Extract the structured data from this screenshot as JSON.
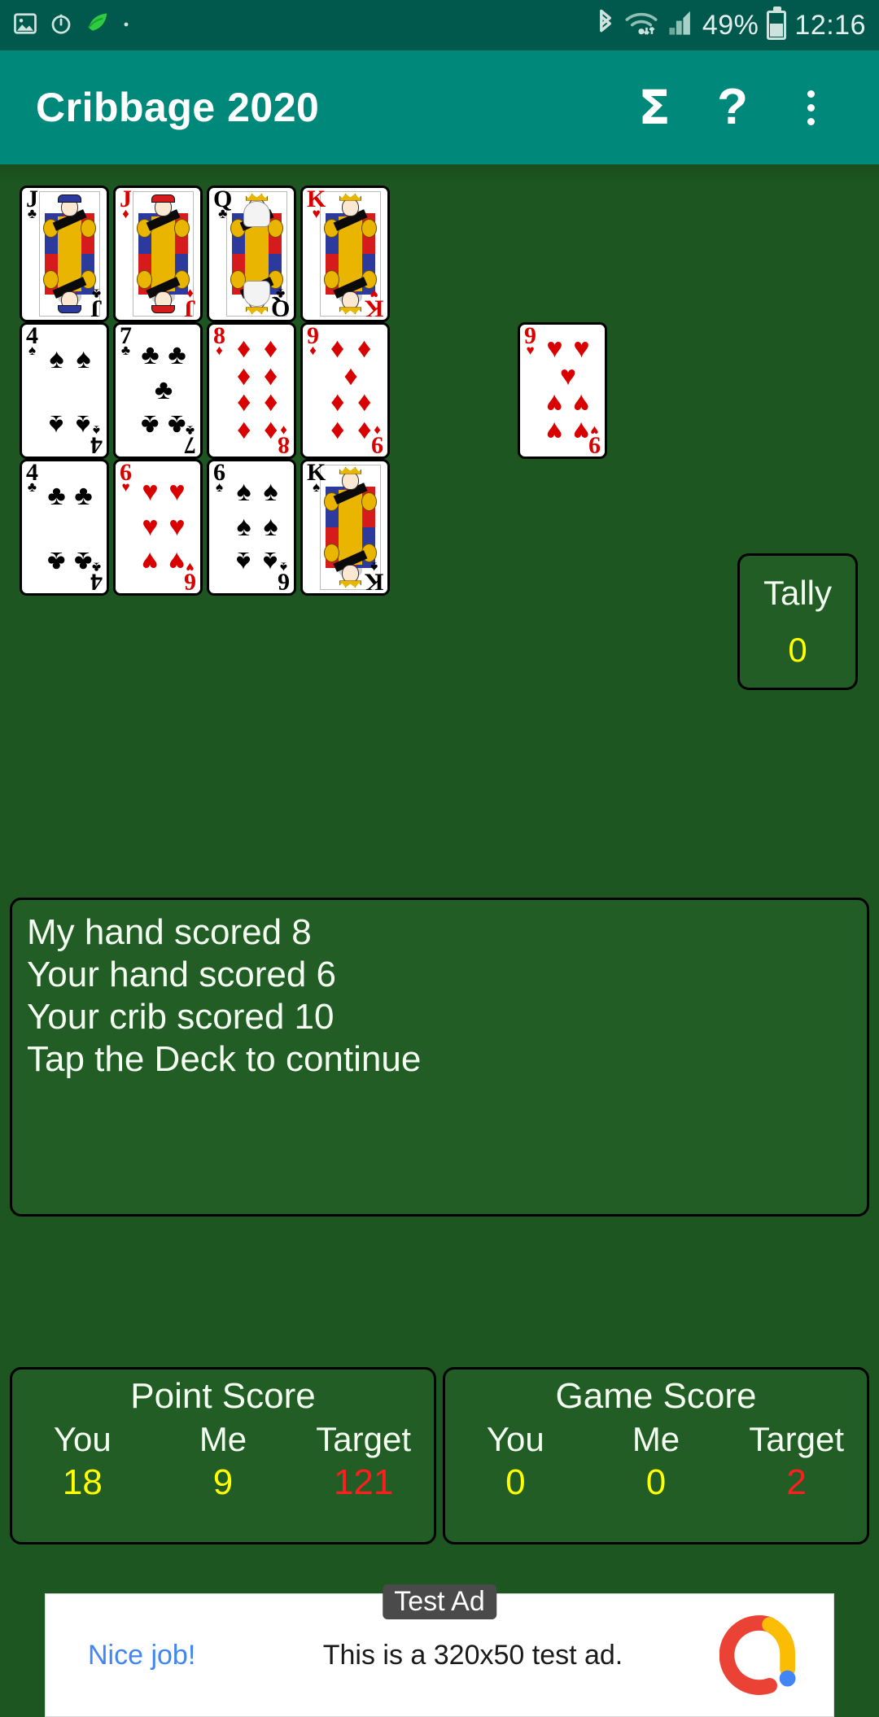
{
  "status_bar": {
    "left_icons": [
      "photo-icon",
      "alarm-icon",
      "leaf-app-icon",
      "dot-icon"
    ],
    "bluetooth_icon": "bluetooth-icon",
    "wifi_icon": "wifi-icon",
    "signal_icon": "cellular-signal-icon",
    "battery_percent": "49%",
    "battery_icon": "battery-icon",
    "time": "12:16"
  },
  "app_bar": {
    "title": "Cribbage 2020",
    "sigma_label": "Σ",
    "help_label": "?",
    "overflow_label": "⋮"
  },
  "board": {
    "rows": [
      [
        {
          "rank": "J",
          "suit": "♣",
          "color": "blk",
          "type": "face",
          "name": "jack-of-clubs"
        },
        {
          "rank": "J",
          "suit": "♦",
          "color": "red",
          "type": "face",
          "name": "jack-of-diamonds"
        },
        {
          "rank": "Q",
          "suit": "♣",
          "color": "blk",
          "type": "face",
          "name": "queen-of-clubs"
        },
        {
          "rank": "K",
          "suit": "♥",
          "color": "red",
          "type": "face",
          "name": "king-of-hearts"
        }
      ],
      [
        {
          "rank": "4",
          "suit": "♠",
          "color": "blk",
          "type": "pip",
          "count": 4,
          "name": "four-of-spades"
        },
        {
          "rank": "7",
          "suit": "♣",
          "color": "blk",
          "type": "pip",
          "count": 7,
          "name": "seven-of-clubs"
        },
        {
          "rank": "8",
          "suit": "♦",
          "color": "red",
          "type": "pip",
          "count": 8,
          "name": "eight-of-diamonds"
        },
        {
          "rank": "9",
          "suit": "♦",
          "color": "red",
          "type": "pip",
          "count": 9,
          "name": "nine-of-diamonds"
        }
      ],
      [
        {
          "rank": "4",
          "suit": "♣",
          "color": "blk",
          "type": "pip",
          "count": 4,
          "name": "four-of-clubs"
        },
        {
          "rank": "6",
          "suit": "♥",
          "color": "red",
          "type": "pip",
          "count": 6,
          "name": "six-of-hearts"
        },
        {
          "rank": "6",
          "suit": "♠",
          "color": "blk",
          "type": "pip",
          "count": 6,
          "name": "six-of-spades"
        },
        {
          "rank": "K",
          "suit": "♠",
          "color": "blk",
          "type": "face",
          "name": "king-of-spades"
        }
      ]
    ],
    "starter_card": {
      "rank": "9",
      "suit": "♥",
      "color": "red",
      "type": "pip",
      "count": 9,
      "name": "nine-of-hearts"
    }
  },
  "tally": {
    "label": "Tally",
    "value": "0"
  },
  "message": {
    "lines": [
      "My hand scored 8",
      "Your hand scored 6",
      "Your crib scored 10",
      "Tap the Deck to continue"
    ]
  },
  "point_score": {
    "title": "Point Score",
    "headers": [
      "You",
      "Me",
      "Target"
    ],
    "values": [
      "18",
      "9",
      "121"
    ]
  },
  "game_score": {
    "title": "Game Score",
    "headers": [
      "You",
      "Me",
      "Target"
    ],
    "values": [
      "0",
      "0",
      "2"
    ]
  },
  "ad": {
    "badge": "Test Ad",
    "cta": "Nice job!",
    "text": "This is a 320x50 test ad.",
    "logo": "admob-logo-icon"
  },
  "colors": {
    "app_bar": "#00897B",
    "status_bar": "#00594C",
    "felt": "#1d5620",
    "panel": "#215d25",
    "yellow": "#ffff00",
    "red": "#ff1e1e",
    "ad_link": "#4285F4"
  }
}
